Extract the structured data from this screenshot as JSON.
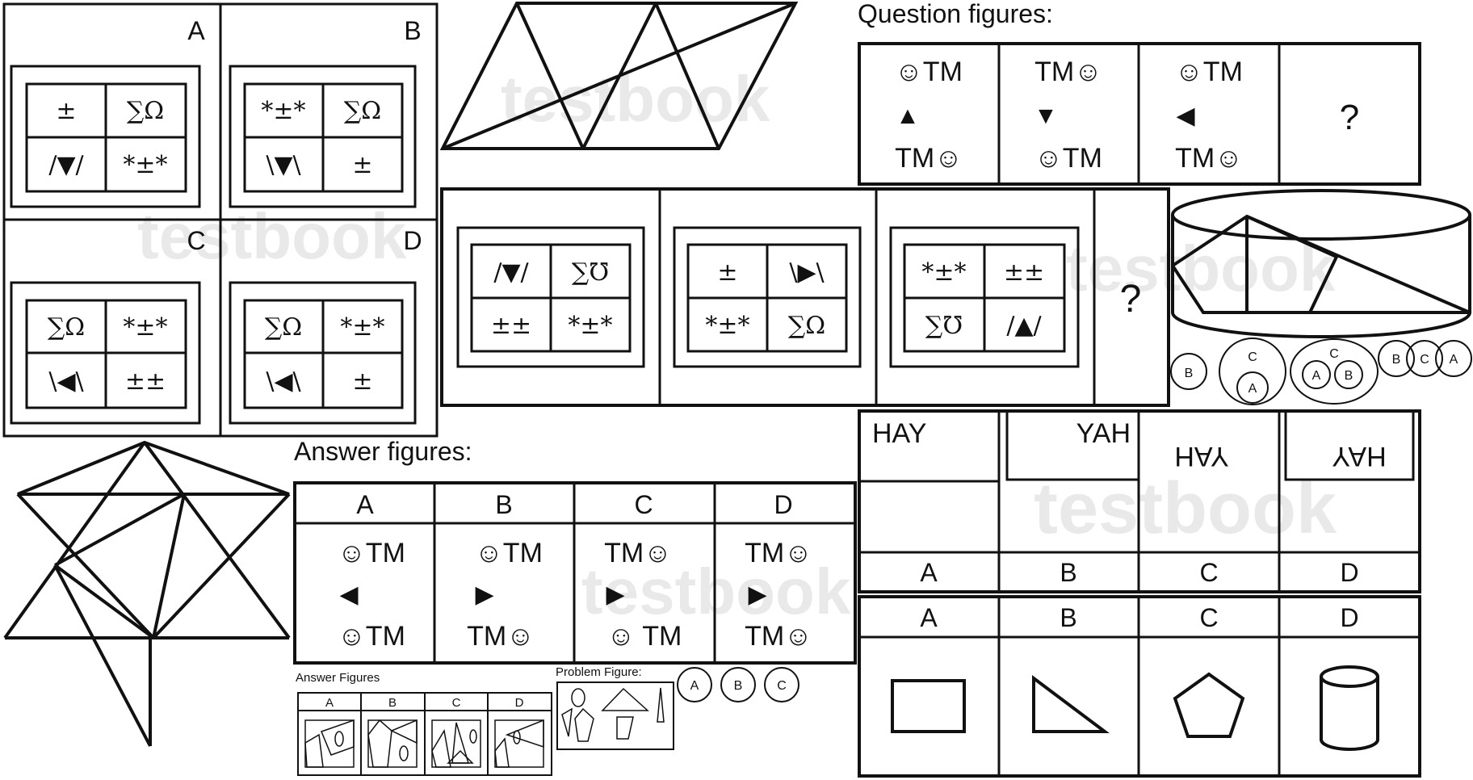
{
  "symbol_panel": {
    "options": [
      {
        "label": "A",
        "cells": [
          "±",
          "∑Ω",
          "/▼/",
          "*±*"
        ]
      },
      {
        "label": "B",
        "cells": [
          "*±*",
          "∑Ω",
          "\\▼\\",
          "±"
        ]
      },
      {
        "label": "C",
        "cells": [
          "∑Ω",
          "*±*",
          "\\◀\\",
          "±±"
        ]
      },
      {
        "label": "D",
        "cells": [
          "∑Ω",
          "*±*",
          "\\◀\\",
          "±"
        ]
      }
    ]
  },
  "symbol_series": {
    "figures": [
      {
        "cells": [
          "/▼/",
          "∑℧",
          "±±",
          "*±*"
        ]
      },
      {
        "cells": [
          "±",
          "\\▶\\",
          "*±*",
          "∑Ω"
        ]
      },
      {
        "cells": [
          "*±*",
          "±±",
          "∑℧",
          "/▲/"
        ]
      }
    ],
    "question_mark": "?"
  },
  "smiley_question": {
    "heading": "Question figures:",
    "figures": [
      {
        "top": "☺TM",
        "arrow": "▲",
        "bottom": "TM☺"
      },
      {
        "top": "TM☺",
        "arrow": "▼",
        "bottom": "☺TM"
      },
      {
        "top": "☺TM",
        "arrow": "◀",
        "bottom": "TM☺"
      }
    ],
    "question_mark": "?"
  },
  "smiley_answers": {
    "heading": "Answer figures:",
    "options": [
      {
        "label": "A",
        "top": "☺TM",
        "arrow": "◀",
        "bottom": "☺TM"
      },
      {
        "label": "B",
        "top": "☺TM",
        "arrow": "▶",
        "bottom": "TM☺"
      },
      {
        "label": "C",
        "top": "TM☺",
        "arrow": "▶",
        "bottom": "☺ TM"
      },
      {
        "label": "D",
        "top": "TM☺",
        "arrow": "▶",
        "bottom": "TM☺"
      }
    ]
  },
  "venn": {
    "labels": [
      "B",
      "C",
      "A",
      "C",
      "A",
      "B",
      "B",
      "C",
      "A"
    ]
  },
  "mirror": {
    "options": [
      {
        "label": "A",
        "text": "HAY"
      },
      {
        "label": "B",
        "text": "YAH"
      },
      {
        "label": "C",
        "text": "HAY"
      },
      {
        "label": "D",
        "text": "HAY"
      }
    ]
  },
  "shapes": {
    "options": [
      {
        "label": "A",
        "shape": "rectangle"
      },
      {
        "label": "B",
        "shape": "triangle"
      },
      {
        "label": "C",
        "shape": "pentagon"
      },
      {
        "label": "D",
        "shape": "cylinder"
      }
    ]
  },
  "small_answers": {
    "heading": "Answer Figures",
    "labels": [
      "A",
      "B",
      "C",
      "D"
    ]
  },
  "problem_figure": {
    "heading": "Problem Figure:",
    "choices": [
      "A",
      "B",
      "C"
    ]
  },
  "watermark": {
    "text": "testbook"
  }
}
